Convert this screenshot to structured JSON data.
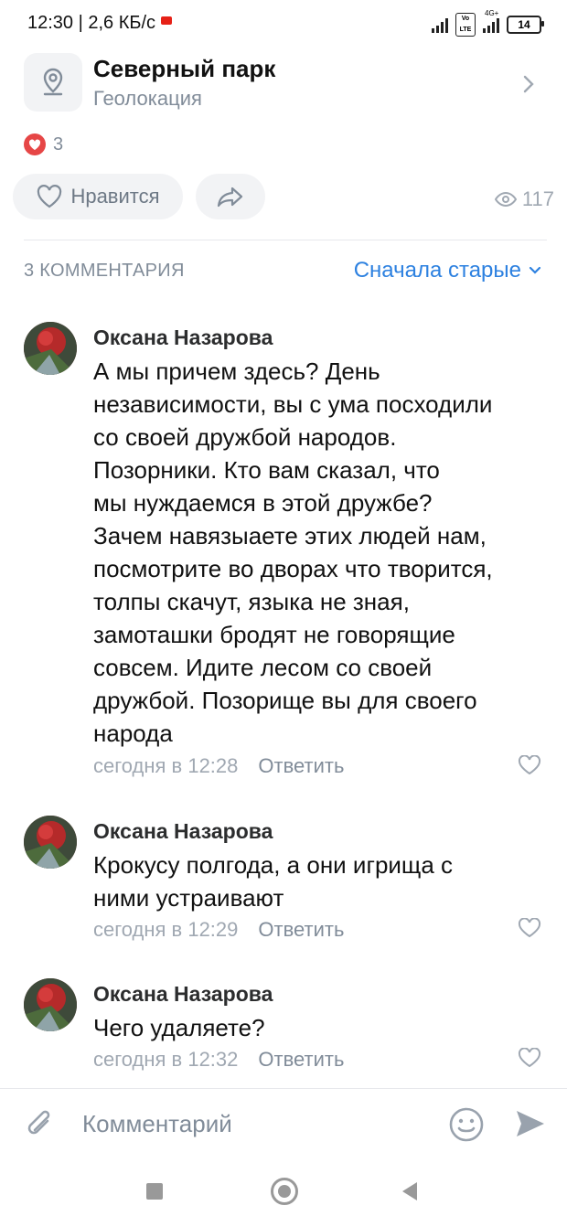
{
  "status_bar": {
    "time_speed": "12:30 | 2,6 КБ/с",
    "network": "4G+",
    "volte": "Vo LTE",
    "battery": "14"
  },
  "location": {
    "title": "Северный парк",
    "subtitle": "Геолокация"
  },
  "reactions": {
    "count": "3"
  },
  "actions": {
    "like_label": "Нравится",
    "views": "117"
  },
  "comments_header": {
    "count_label": "3 КОММЕНТАРИЯ",
    "sort_label": "Сначала старые"
  },
  "comments": [
    {
      "author": "Оксана Назарова",
      "text_lines": [
        "А мы причем здесь? День",
        "независимости, вы с ума посходили",
        "со своей дружбой народов.",
        "Позорники. Кто вам сказал, что",
        "мы нуждаемся в этой дружбе?",
        "Зачем навязыаете этих людей нам,",
        "посмотрите во дворах что творится,",
        "толпы скачут, языка не зная,",
        "замоташки бродят не говорящие",
        "совсем. Идите лесом со своей",
        "дружбой. Позорище вы для своего",
        "народа"
      ],
      "time": "сегодня в 12:28",
      "reply_label": "Ответить"
    },
    {
      "author": "Оксана Назарова",
      "text_lines": [
        "Крокусу полгода, а они игрища с",
        "ними устраивают"
      ],
      "time": "сегодня в 12:29",
      "reply_label": "Ответить"
    },
    {
      "author": "Оксана Назарова",
      "text_lines": [
        "Чего удаляете?"
      ],
      "time": "сегодня в 12:32",
      "reply_label": "Ответить"
    }
  ],
  "input": {
    "placeholder": "Комментарий"
  },
  "colors": {
    "accent": "#2d81e0",
    "heart": "#e64646",
    "secondary_text": "#818c99"
  }
}
